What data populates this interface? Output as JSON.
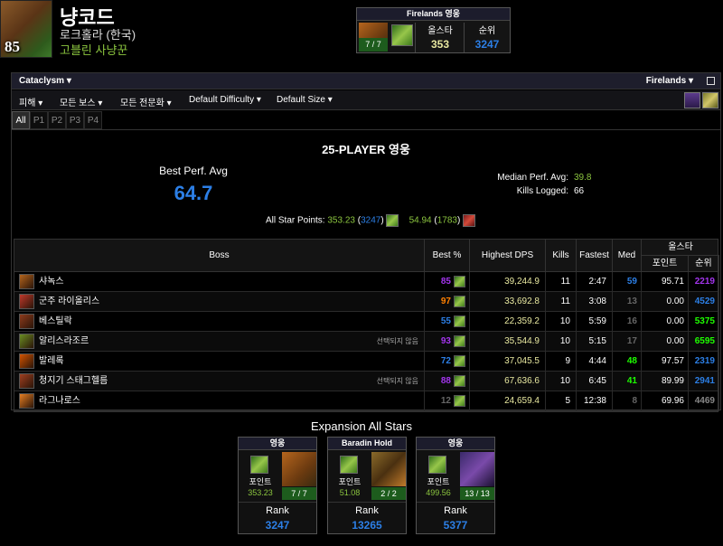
{
  "header": {
    "name": "냥코드",
    "server": "로크홀라 (한국)",
    "class": "고블린 사냥꾼",
    "level": "85"
  },
  "summary": {
    "title": "Firelands 영웅",
    "kills": "7 / 7",
    "allstar_label": "올스타",
    "allstar_value": "353",
    "rank_label": "순위",
    "rank_value": "3247"
  },
  "filters": {
    "expansion": "Cataclysm",
    "zone": "Firelands",
    "metric": "피해",
    "bosses": "모든 보스",
    "specs": "모든 전문화",
    "difficulty": "Default Difficulty",
    "size": "Default Size"
  },
  "tabs": [
    "All",
    "P1",
    "P2",
    "P3",
    "P4"
  ],
  "stats": {
    "difficulty_title": "25-PLAYER 영웅",
    "best_perf_label": "Best Perf. Avg",
    "best_perf_value": "64.7",
    "median_label": "Median Perf. Avg:",
    "median_value": "39.8",
    "kills_label": "Kills Logged:",
    "kills_value": "66",
    "allstar_label": "All Star Points:",
    "allstar_points_1": "353.23",
    "allstar_rank_1": "3247",
    "allstar_points_2": "54.94",
    "allstar_rank_2": "1783"
  },
  "table": {
    "headers": {
      "boss": "Boss",
      "best": "Best %",
      "dps": "Highest DPS",
      "kills": "Kills",
      "fastest": "Fastest",
      "med": "Med",
      "allstar": "올스타",
      "points": "포인트",
      "rank": "순위"
    },
    "rows": [
      {
        "boss": "샤녹스",
        "note": "",
        "best": "85",
        "best_color": "#a335ee",
        "dps": "39,244.9",
        "kills": "11",
        "fastest": "2:47",
        "med": "59",
        "med_color": "#2c7fe6",
        "points": "95.71",
        "rank": "2219",
        "rank_color": "#a335ee",
        "icon_color": "#b5651d"
      },
      {
        "boss": "군주 라이올리스",
        "note": "",
        "best": "97",
        "best_color": "#ff8000",
        "dps": "33,692.8",
        "kills": "11",
        "fastest": "3:08",
        "med": "13",
        "med_color": "#666666",
        "points": "0.00",
        "rank": "4529",
        "rank_color": "#2c7fe6",
        "icon_color": "#c0392b"
      },
      {
        "boss": "베스틸락",
        "note": "",
        "best": "55",
        "best_color": "#2c7fe6",
        "dps": "22,359.2",
        "kills": "10",
        "fastest": "5:59",
        "med": "16",
        "med_color": "#666666",
        "points": "0.00",
        "rank": "5375",
        "rank_color": "#1eff00",
        "icon_color": "#8e3b1c"
      },
      {
        "boss": "알리스라조르",
        "note": "선택되지 않음",
        "best": "93",
        "best_color": "#a335ee",
        "dps": "35,544.9",
        "kills": "10",
        "fastest": "5:15",
        "med": "17",
        "med_color": "#666666",
        "points": "0.00",
        "rank": "6595",
        "rank_color": "#1eff00",
        "icon_color": "#6b8e23"
      },
      {
        "boss": "발레록",
        "note": "",
        "best": "72",
        "best_color": "#2c7fe6",
        "dps": "37,045.5",
        "kills": "9",
        "fastest": "4:44",
        "med": "48",
        "med_color": "#1eff00",
        "points": "97.57",
        "rank": "2319",
        "rank_color": "#2c7fe6",
        "icon_color": "#d35400"
      },
      {
        "boss": "청지기 스태그헬름",
        "note": "선택되지 않음",
        "best": "88",
        "best_color": "#a335ee",
        "dps": "67,636.6",
        "kills": "10",
        "fastest": "6:45",
        "med": "41",
        "med_color": "#1eff00",
        "points": "89.99",
        "rank": "2941",
        "rank_color": "#2c7fe6",
        "icon_color": "#a04020"
      },
      {
        "boss": "라그나로스",
        "note": "",
        "best": "12",
        "best_color": "#666666",
        "dps": "24,659.4",
        "kills": "5",
        "fastest": "12:38",
        "med": "8",
        "med_color": "#666666",
        "points": "69.96",
        "rank": "4469",
        "rank_color": "#888888",
        "icon_color": "#e67e22"
      }
    ]
  },
  "expansion": {
    "title": "Expansion All Stars",
    "cards": [
      {
        "title": "영웅",
        "points_label": "포인트",
        "points": "353.23",
        "count": "7 / 7",
        "rank_label": "Rank",
        "rank": "3247"
      },
      {
        "title": "Baradin Hold",
        "points_label": "포인트",
        "points": "51.08",
        "count": "2 / 2",
        "rank_label": "Rank",
        "rank": "13265"
      },
      {
        "title": "영웅",
        "points_label": "포인트",
        "points": "499.56",
        "count": "13 / 13",
        "rank_label": "Rank",
        "rank": "5377"
      }
    ]
  },
  "colors": {
    "accent_blue": "#2c7fe6",
    "uncommon_green": "#1eff00",
    "epic_purple": "#a335ee",
    "legendary_orange": "#ff8000",
    "points_green": "#8cc63f",
    "dps_yellow": "#e8e8a0"
  }
}
